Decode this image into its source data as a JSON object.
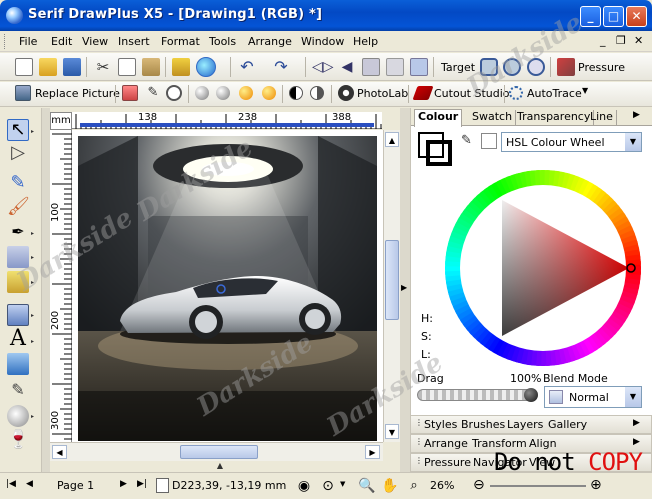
{
  "window": {
    "title": "Serif DrawPlus X5 - [Drawing1 (RGB) *]",
    "minimize_label": "_",
    "maximize_label": "□",
    "close_label": "✕"
  },
  "menubar": {
    "items": [
      "File",
      "Edit",
      "View",
      "Insert",
      "Format",
      "Tools",
      "Arrange",
      "Window",
      "Help"
    ],
    "doc_min": "_",
    "doc_restore": "❐",
    "doc_close": "✕"
  },
  "toolbar1": {
    "target_label": "Target",
    "pressure_label": "Pressure"
  },
  "toolbar2": {
    "replace_picture_label": "Replace Picture",
    "photolab_label": "PhotoLab",
    "cutout_label": "Cutout Studio",
    "autotrace_label": "AutoTrace"
  },
  "rulers": {
    "units": "mm",
    "top_ticks": [
      "138",
      "238",
      "388"
    ],
    "left_ticks": [
      "100",
      "200",
      "300"
    ]
  },
  "status": {
    "page_label": "Page 1",
    "coords": "D223,39, -13,19 mm",
    "zoom": "26%"
  },
  "colour_panel": {
    "tabs": [
      "Colour",
      "Swatch",
      "Transparency",
      "Line"
    ],
    "mode_select": "HSL Colour Wheel",
    "h_label": "H:",
    "s_label": "S:",
    "l_label": "L:",
    "drag_label": "Drag",
    "opacity_value": "100%",
    "blend_mode_label": "Blend Mode",
    "blend_mode_value": "Normal"
  },
  "panel_rows": [
    {
      "items": [
        "Styles",
        "Brushes",
        "Layers",
        "Gallery"
      ]
    },
    {
      "items": [
        "Arrange",
        "Transform",
        "Align"
      ]
    },
    {
      "items": [
        "Pressure",
        "Navigator",
        "View"
      ]
    }
  ],
  "watermarks": [
    "Darkside",
    "Darkside",
    "Darkside",
    "Darkside",
    "Darkside"
  ],
  "overlay_text": {
    "do_not": "Do not ",
    "copy": "COPY"
  },
  "colors": {
    "titlebar": "#0349c4",
    "accent": "#316ac5",
    "wheel_red": "#ff0000",
    "copy_red": "#e01010"
  }
}
